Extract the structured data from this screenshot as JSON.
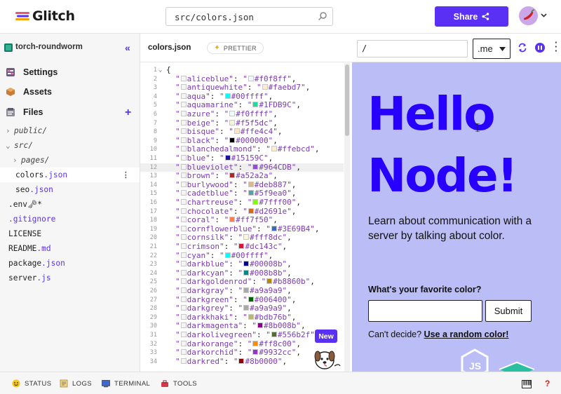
{
  "header": {
    "logo_text": "Glitch",
    "search_value": "src/colors.json",
    "share_label": "Share"
  },
  "sidebar": {
    "project_name": "torch-roundworm",
    "nav": [
      {
        "label": "Settings",
        "icon": "settings-icon"
      },
      {
        "label": "Assets",
        "icon": "assets-icon"
      },
      {
        "label": "Files",
        "icon": "files-icon"
      }
    ],
    "tree": [
      {
        "name": "public/",
        "type": "dir",
        "depth": 0,
        "expanded": false
      },
      {
        "name": "src/",
        "type": "dir",
        "depth": 0,
        "expanded": true
      },
      {
        "name": "pages/",
        "type": "dir",
        "depth": 1,
        "expanded": false
      },
      {
        "base": "colors",
        "ext": ".json",
        "depth": 1,
        "selected": true
      },
      {
        "base": "seo",
        "ext": ".json",
        "depth": 1
      },
      {
        "base": ".env",
        "ext": "",
        "suffix": " 🗝*",
        "depth": 0
      },
      {
        "base": ".gitignore",
        "ext": "",
        "purple": true,
        "depth": 0
      },
      {
        "base": "LICENSE",
        "ext": "",
        "depth": 0
      },
      {
        "base": "README",
        "ext": ".md",
        "depth": 0
      },
      {
        "base": "package",
        "ext": ".json",
        "depth": 0
      },
      {
        "base": "server",
        "ext": ".js",
        "depth": 0
      }
    ]
  },
  "editor": {
    "tab_name": "colors.json",
    "prettier_label": "PRETTIER",
    "new_badge": "New",
    "highlight_line": 12,
    "lines": [
      {
        "n": "1",
        "open": "{"
      },
      {
        "n": "2",
        "name": "aliceblue",
        "hex": "#f0f8ff"
      },
      {
        "n": "3",
        "name": "antiquewhite",
        "hex": "#faebd7"
      },
      {
        "n": "4",
        "name": "aqua",
        "hex": "#00ffff"
      },
      {
        "n": "5",
        "name": "aquamarine",
        "hex": "#1FDB9C"
      },
      {
        "n": "6",
        "name": "azure",
        "hex": "#f0ffff"
      },
      {
        "n": "7",
        "name": "beige",
        "hex": "#f5f5dc"
      },
      {
        "n": "8",
        "name": "bisque",
        "hex": "#ffe4c4"
      },
      {
        "n": "9",
        "name": "black",
        "hex": "#000000"
      },
      {
        "n": "10",
        "name": "blanchedalmond",
        "hex": "#ffebcd"
      },
      {
        "n": "11",
        "name": "blue",
        "hex": "#15159C"
      },
      {
        "n": "12",
        "name": "blueviolet",
        "hex": "#964CDB"
      },
      {
        "n": "13",
        "name": "brown",
        "hex": "#a52a2a"
      },
      {
        "n": "14",
        "name": "burlywood",
        "hex": "#deb887"
      },
      {
        "n": "15",
        "name": "cadetblue",
        "hex": "#5f9ea0"
      },
      {
        "n": "16",
        "name": "chartreuse",
        "hex": "#7fff00"
      },
      {
        "n": "17",
        "name": "chocolate",
        "hex": "#d2691e"
      },
      {
        "n": "18",
        "name": "coral",
        "hex": "#ff7f50"
      },
      {
        "n": "19",
        "name": "cornflowerblue",
        "hex": "#3E69B4"
      },
      {
        "n": "20",
        "name": "cornsilk",
        "hex": "#fff8dc"
      },
      {
        "n": "21",
        "name": "crimson",
        "hex": "#dc143c"
      },
      {
        "n": "22",
        "name": "cyan",
        "hex": "#00ffff"
      },
      {
        "n": "23",
        "name": "darkblue",
        "hex": "#00008b"
      },
      {
        "n": "24",
        "name": "darkcyan",
        "hex": "#008b8b"
      },
      {
        "n": "25",
        "name": "darkgoldenrod",
        "hex": "#b8860b"
      },
      {
        "n": "26",
        "name": "darkgray",
        "hex": "#a9a9a9"
      },
      {
        "n": "27",
        "name": "darkgreen",
        "hex": "#006400"
      },
      {
        "n": "28",
        "name": "darkgrey",
        "hex": "#a9a9a9"
      },
      {
        "n": "29",
        "name": "darkkhaki",
        "hex": "#bdb76b"
      },
      {
        "n": "30",
        "name": "darkmagenta",
        "hex": "#8b008b"
      },
      {
        "n": "31",
        "name": "darkolivegreen",
        "hex": "#556b2f"
      },
      {
        "n": "32",
        "name": "darkorange",
        "hex": "#ff8c00"
      },
      {
        "n": "33",
        "name": "darkorchid",
        "hex": "#9932cc"
      },
      {
        "n": "34",
        "name": "darkred",
        "hex": "#8b0000"
      }
    ]
  },
  "preview_bar": {
    "path_value": "/",
    "domain_value": ".me"
  },
  "preview": {
    "hello_line1": "Hello",
    "hello_line2": "Node!",
    "lead": "Learn about communication with a server by talking about color.",
    "favorite_label": "What's your favorite color?",
    "submit_label": "Submit",
    "cant_decide": "Can't decide?",
    "random_link": "Use a random color!"
  },
  "statusbar": {
    "items": [
      {
        "label": "STATUS",
        "icon": "status-smiley-icon"
      },
      {
        "label": "LOGS",
        "icon": "logs-icon"
      },
      {
        "label": "TERMINAL",
        "icon": "terminal-icon"
      },
      {
        "label": "TOOLS",
        "icon": "tools-icon"
      }
    ],
    "help": "?"
  },
  "colors": {
    "accent": "#5a31f4",
    "hello": "#2800ff",
    "preview_bg": "#bbbdf6"
  }
}
